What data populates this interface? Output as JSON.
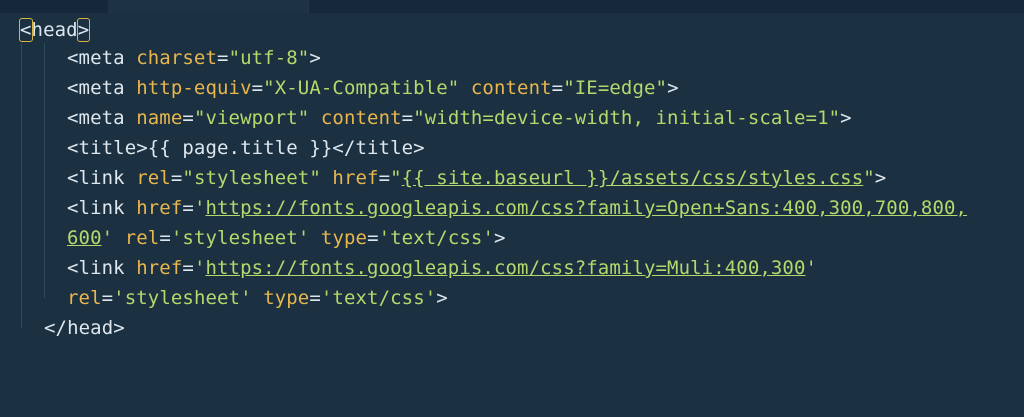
{
  "colors": {
    "background": "#1b3040",
    "tag_text": "#dfe7ee",
    "attribute": "#e9b64d",
    "string": "#b5d86c",
    "active_tab_accent": "#e5b422"
  },
  "code": {
    "l1": {
      "open": "<",
      "name": "head",
      "close": ">"
    },
    "l2": {
      "pre": "<meta ",
      "a1": "charset",
      "eq": "=",
      "v1": "\"utf-8\"",
      "post": ">"
    },
    "l3": {
      "pre": "<meta ",
      "a1": "http-equiv",
      "eq1": "=",
      "v1": "\"X-UA-Compatible\"",
      "sp": " ",
      "a2": "content",
      "eq2": "=",
      "v2": "\"IE=edge\"",
      "post": ">"
    },
    "l4": {
      "pre": "<meta ",
      "a1": "name",
      "eq1": "=",
      "v1": "\"viewport\"",
      "sp": " ",
      "a2": "content",
      "eq2": "=",
      "v2": "\"width=device-width, initial-scale=1\"",
      "post": ">"
    },
    "l5": {
      "text": "<title>{{ page.title }}</title>"
    },
    "l6": {
      "pre": "<link ",
      "a1": "rel",
      "eq1": "=",
      "v1": "\"stylesheet\"",
      "sp": " ",
      "a2": "href",
      "eq2": "=",
      "q1": "\"",
      "v2": "{{ site.baseurl }}/assets/css/styles.css",
      "q2": "\"",
      "post": ">"
    },
    "l7": {
      "pre": "<link ",
      "a1": "href",
      "eq1": "=",
      "q1": "'",
      "v1": "https://fonts.googleapis.com/css?family=Open+Sans:400,300,700,800,"
    },
    "l8": {
      "v1": "600",
      "q1": "'",
      "sp": " ",
      "a1": "rel",
      "eq1": "=",
      "v2": "'stylesheet'",
      "sp2": " ",
      "a2": "type",
      "eq2": "=",
      "v3": "'text/css'",
      "post": ">"
    },
    "l9": {
      "pre": "<link ",
      "a1": "href",
      "eq1": "=",
      "q1": "'",
      "v1": "https://fonts.googleapis.com/css?family=Muli:400,300",
      "q2": "'"
    },
    "l10": {
      "a1": "rel",
      "eq1": "=",
      "v1": "'stylesheet'",
      "sp": " ",
      "a2": "type",
      "eq2": "=",
      "v2": "'text/css'",
      "post": ">"
    },
    "l11": {
      "text": "</head>"
    }
  }
}
